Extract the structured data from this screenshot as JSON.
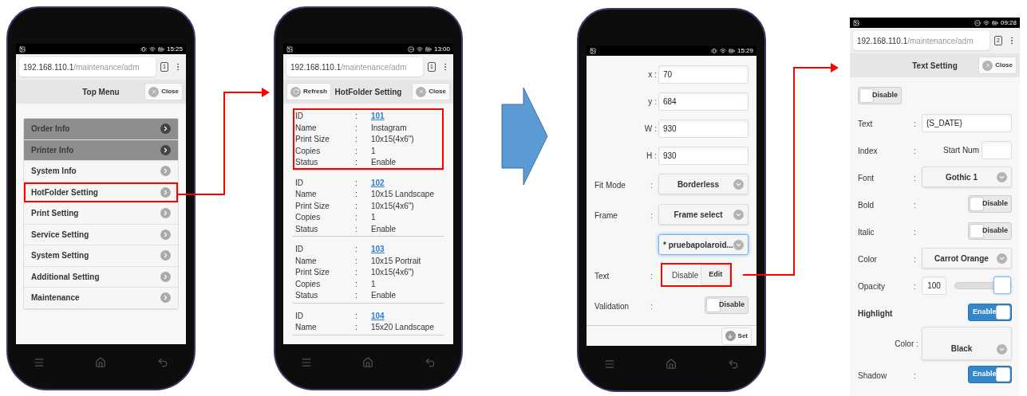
{
  "screens": [
    {
      "kind": "menu",
      "dnd": false,
      "status_time": "15:25",
      "url": {
        "host": "192.168.110.1",
        "path": "/maintenance/adm",
        "tab_count": "1"
      },
      "header": {
        "title": "Top Menu",
        "close": "Close"
      },
      "menu": [
        {
          "label": "Order Info",
          "disabled": true,
          "highlighted": false
        },
        {
          "label": "Printer Info",
          "disabled": true,
          "highlighted": false
        },
        {
          "label": "System Info",
          "disabled": false,
          "highlighted": false
        },
        {
          "label": "HotFolder Setting",
          "disabled": false,
          "highlighted": true
        },
        {
          "label": "Print Setting",
          "disabled": false,
          "highlighted": false
        },
        {
          "label": "Service Setting",
          "disabled": false,
          "highlighted": false
        },
        {
          "label": "System Setting",
          "disabled": false,
          "highlighted": false
        },
        {
          "label": "Additional Setting",
          "disabled": false,
          "highlighted": false
        },
        {
          "label": "Maintenance",
          "disabled": false,
          "highlighted": false
        }
      ]
    },
    {
      "kind": "records",
      "dnd": true,
      "status_time": "13:00",
      "url": {
        "host": "192.168.110.1",
        "path": "/maintenance/adm",
        "tab_count": "1"
      },
      "header": {
        "refresh": "Refresh",
        "title": "HotFolder Setting",
        "close": "Close"
      },
      "records": [
        {
          "highlighted": true,
          "fields": [
            {
              "label": "ID",
              "sep": ":",
              "value": "101",
              "kind": "link"
            },
            {
              "label": "Name",
              "sep": ":",
              "value": "Instagram",
              "kind": "text"
            },
            {
              "label": "Print Size",
              "sep": ":",
              "value": "10x15(4x6\")",
              "kind": "text"
            },
            {
              "label": "Copies",
              "sep": ":",
              "value": "1",
              "kind": "text"
            },
            {
              "label": "Status",
              "sep": ":",
              "value": "Enable",
              "kind": "text"
            }
          ]
        },
        {
          "highlighted": false,
          "fields": [
            {
              "label": "ID",
              "sep": ":",
              "value": "102",
              "kind": "link"
            },
            {
              "label": "Name",
              "sep": ":",
              "value": "10x15 Landscape",
              "kind": "text"
            },
            {
              "label": "Print Size",
              "sep": ":",
              "value": "10x15(4x6\")",
              "kind": "text"
            },
            {
              "label": "Copies",
              "sep": ":",
              "value": "1",
              "kind": "text"
            },
            {
              "label": "Status",
              "sep": ":",
              "value": "Enable",
              "kind": "text"
            }
          ]
        },
        {
          "highlighted": false,
          "fields": [
            {
              "label": "ID",
              "sep": ":",
              "value": "103",
              "kind": "link"
            },
            {
              "label": "Name",
              "sep": ":",
              "value": "10x15 Portrait",
              "kind": "text"
            },
            {
              "label": "Print Size",
              "sep": ":",
              "value": "10x15(4x6\")",
              "kind": "text"
            },
            {
              "label": "Copies",
              "sep": ":",
              "value": "1",
              "kind": "text"
            },
            {
              "label": "Status",
              "sep": ":",
              "value": "Enable",
              "kind": "text"
            }
          ]
        },
        {
          "highlighted": false,
          "fields": [
            {
              "label": "ID",
              "sep": ":",
              "value": "104",
              "kind": "link"
            },
            {
              "label": "Name",
              "sep": ":",
              "value": "15x20 Landscape",
              "kind": "text"
            }
          ]
        }
      ]
    },
    {
      "kind": "form",
      "dnd": false,
      "status_time": "15:29",
      "rows": [
        {
          "kind": "coord",
          "label": "x",
          "sep": ":",
          "value": "70"
        },
        {
          "kind": "coord",
          "label": "y",
          "sep": ":",
          "value": "684"
        },
        {
          "kind": "coord",
          "label": "W",
          "sep": ":",
          "value": "930"
        },
        {
          "kind": "coord",
          "label": "H",
          "sep": ":",
          "value": "930"
        },
        {
          "kind": "select",
          "label": "Fit Mode",
          "sep": ":",
          "value": "Borderless",
          "focused": false
        },
        {
          "kind": "select",
          "label": "Frame",
          "sep": ":",
          "value": "Frame select",
          "focused": false
        },
        {
          "kind": "select",
          "value": "* pruebapolaroid...",
          "focused": true
        },
        {
          "kind": "text-edit",
          "label": "Text",
          "sep": ":",
          "status": "Disable",
          "button": "Edit",
          "highlighted": true
        },
        {
          "kind": "toggle",
          "label": "Validation",
          "sep": ":",
          "value": "Disable",
          "on": false
        }
      ],
      "footer": {
        "button": "Set"
      }
    },
    {
      "kind": "form",
      "dnd": true,
      "status_time": "09:28",
      "url": {
        "host": "192.168.110.1",
        "path": "/maintenance/adm",
        "tab_count": "2"
      },
      "header": {
        "title": "Text Setting",
        "close": "Close"
      },
      "rows": [
        {
          "kind": "toggle",
          "value": "Disable",
          "on": false
        },
        {
          "kind": "field",
          "label": "Text",
          "sep": ":",
          "value": "{S_DATE}"
        },
        {
          "kind": "index",
          "label": "Index",
          "sep": ":",
          "caption": "Start Num"
        },
        {
          "kind": "select",
          "label": "Font",
          "sep": ":",
          "value": "Gothic 1",
          "focused": false
        },
        {
          "kind": "toggle",
          "label": "Bold",
          "sep": ":",
          "value": "Disable",
          "on": false
        },
        {
          "kind": "toggle",
          "label": "Italic",
          "sep": ":",
          "value": "Disable",
          "on": false
        },
        {
          "kind": "select",
          "label": "Color",
          "sep": ":",
          "value": "Carrot Orange",
          "focused": false
        },
        {
          "kind": "slider",
          "label": "Opacity",
          "sep": ":",
          "value": "100",
          "level": 1
        },
        {
          "kind": "heading-toggle",
          "label": "Highlight",
          "value": "Enable",
          "on": true
        },
        {
          "kind": "sub-select",
          "label": "Color",
          "sep": ":",
          "value": "Black",
          "focused": false
        },
        {
          "kind": "toggle",
          "label": "Shadow",
          "sep": ":",
          "value": "Enable",
          "on": true
        }
      ]
    }
  ]
}
